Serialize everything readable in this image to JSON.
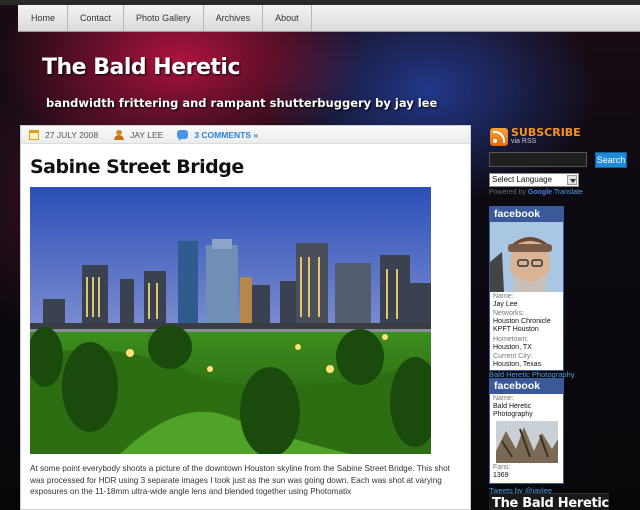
{
  "nav": {
    "items": [
      "Home",
      "Contact",
      "Photo Gallery",
      "Archives",
      "About"
    ]
  },
  "header": {
    "title": "The Bald Heretic",
    "tagline": "bandwidth frittering and rampant shutterbuggery by jay lee"
  },
  "post": {
    "date": "27 JULY 2008",
    "author": "JAY LEE",
    "comments": "3 COMMENTS »",
    "title": "Sabine Street Bridge",
    "body": "At some point everybody shoots a picture of the downtown Houston skyline from the Sabine Street Bridge. This shot was processed for HDR using 3 separate images I took just as the sun was going down. Each was shot at varying exposures on the 11-18mm ultra-wide angle lens and blended together using Photomatix"
  },
  "sidebar": {
    "subscribe_title": "SUBSCRIBE",
    "subscribe_sub": "via RSS",
    "search_button": "Search",
    "language_select": "Select Language",
    "powered_by": "Powered by",
    "powered_google": "Google",
    "powered_translate": "Translate",
    "fb1": {
      "logo": "facebook",
      "name_label": "Name:",
      "name": "Jay Lee",
      "networks_label": "Networks:",
      "networks1": "Houston Chronicle",
      "networks2": "KPFT Houston",
      "hometown_label": "Hometown:",
      "hometown": "Houston, TX",
      "city_label": "Current City:",
      "city": "Houston, Texas"
    },
    "fb_link": "Bald Heretic Photography",
    "fb2": {
      "logo": "facebook",
      "name_label": "Name:",
      "name1": "Bald Heretic",
      "name2": "Photography",
      "fans_label": "Fans:",
      "fans": "1369"
    },
    "tweets_link": "Tweets by @jaylee",
    "bottom_title": "The Bald Heretic"
  }
}
